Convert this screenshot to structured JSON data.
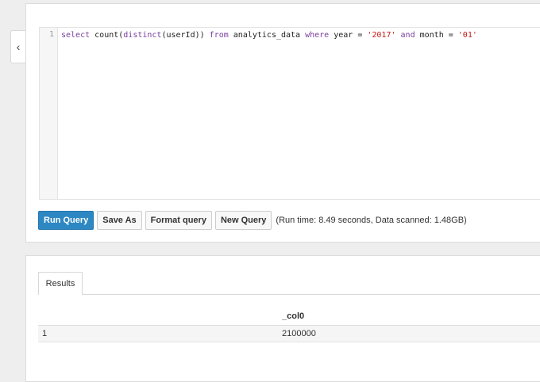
{
  "sidebar_toggle": {
    "icon": "chevron-left-icon",
    "glyph": "‹"
  },
  "editor": {
    "line_number": "1",
    "query_tokens": [
      {
        "t": "select ",
        "c": "kw"
      },
      {
        "t": "count(",
        "c": ""
      },
      {
        "t": "distinct",
        "c": "kw"
      },
      {
        "t": "(userId)) ",
        "c": ""
      },
      {
        "t": "from",
        "c": "kw"
      },
      {
        "t": " analytics_data ",
        "c": ""
      },
      {
        "t": "where",
        "c": "kw"
      },
      {
        "t": " year = ",
        "c": ""
      },
      {
        "t": "'2017'",
        "c": "str"
      },
      {
        "t": " ",
        "c": ""
      },
      {
        "t": "and",
        "c": "kw"
      },
      {
        "t": " month = ",
        "c": ""
      },
      {
        "t": "'01'",
        "c": "str"
      }
    ]
  },
  "toolbar": {
    "run_query": "Run Query",
    "save_as": "Save As",
    "format_query": "Format query",
    "new_query": "New Query",
    "run_info": "(Run time: 8.49 seconds, Data scanned: 1.48GB)"
  },
  "results": {
    "tab_label": "Results",
    "columns": [
      "",
      "_col0"
    ],
    "rows": [
      [
        "1",
        "2100000"
      ]
    ]
  },
  "colors": {
    "primary": "#2d87c3",
    "keyword": "#7a3e9d",
    "string": "#c41a16"
  }
}
